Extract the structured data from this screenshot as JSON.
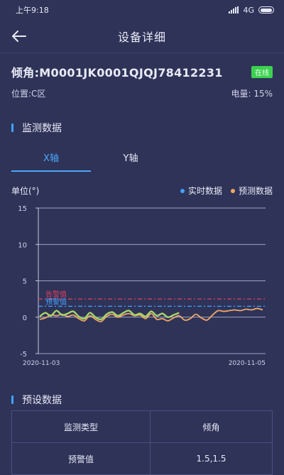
{
  "status_bar": {
    "time": "上午9:18",
    "network": "4G"
  },
  "nav": {
    "title": "设备详细"
  },
  "device": {
    "name": "倾角:M0001JK0001QJQJ78412231",
    "status": "在线",
    "location": "位置:C区",
    "battery": "电量:  15%"
  },
  "monitor": {
    "section_title": "监测数据",
    "tabs": [
      "X轴",
      "Y轴"
    ],
    "active_tab": 0
  },
  "legend": {
    "unit": "单位(°)",
    "items": [
      {
        "label": "实时数据",
        "color": "#3fa4ff"
      },
      {
        "label": "预测数据",
        "color": "#f0a868"
      }
    ]
  },
  "chart_data": {
    "type": "line",
    "ylim": [
      -5,
      15
    ],
    "yticks": [
      "15",
      "10",
      "5",
      "0",
      "-5"
    ],
    "x_start_label": "2020-11-03",
    "x_end_label": "2020-11-05",
    "series": [
      {
        "name": "实时数据",
        "color": "#a6d66a",
        "values": [
          0.1,
          0.6,
          0.2,
          0.9,
          0.3,
          0.5,
          0.8,
          0.1,
          -0.2,
          0.6,
          0.0,
          -0.3,
          0.4,
          0.7,
          0.2,
          0.6,
          0.9,
          0.3,
          0.5,
          0.1,
          0.8,
          0.2,
          0.5,
          0.0,
          0.3,
          0.6
        ]
      },
      {
        "name": "预测数据",
        "color": "#f0a868",
        "values": [
          -0.3,
          -0.1,
          0.3,
          0.2,
          0.4,
          0.1,
          0.3,
          -0.2,
          -0.5,
          0.2,
          -0.3,
          -0.6,
          0.1,
          0.4,
          0.0,
          0.3,
          0.5,
          0.2,
          0.3,
          -0.2,
          0.5,
          -0.3,
          -0.2,
          -0.5,
          -0.1,
          0.2,
          -0.4,
          -0.2,
          0.4,
          -0.1,
          -0.4,
          0.3,
          0.9,
          0.8,
          0.9,
          1.0,
          0.9,
          1.1,
          1.0,
          1.2,
          1.0
        ]
      }
    ],
    "thresholds": [
      {
        "label": "告警值",
        "value": 2.5,
        "color": "#e0405f"
      },
      {
        "label": "预警值",
        "value": 1.5,
        "color": "#3fa4ff"
      }
    ]
  },
  "preset": {
    "section_title": "预设数据",
    "rows": [
      [
        "监测类型",
        "倾角"
      ],
      [
        "预警值",
        "1.5,1.5"
      ]
    ]
  }
}
